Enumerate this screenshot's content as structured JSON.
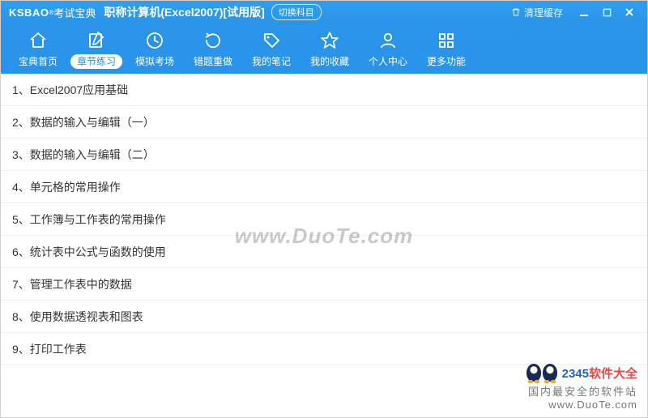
{
  "title": {
    "logo_en": "KSBAO",
    "logo_sup": "®",
    "logo_cn": "考试宝典",
    "main": "职称计算机(Excel2007)",
    "trial": "[试用版]",
    "switch_subject": "切换科目",
    "clear_cache": "清理缓存"
  },
  "toolbar": {
    "items": [
      {
        "label": "宝典首页",
        "icon": "home"
      },
      {
        "label": "章节练习",
        "icon": "edit",
        "active": true
      },
      {
        "label": "模拟考场",
        "icon": "clock"
      },
      {
        "label": "错题重做",
        "icon": "redo"
      },
      {
        "label": "我的笔记",
        "icon": "tag"
      },
      {
        "label": "我的收藏",
        "icon": "star"
      },
      {
        "label": "个人中心",
        "icon": "user"
      },
      {
        "label": "更多功能",
        "icon": "grid"
      }
    ]
  },
  "chapters": [
    "1、Excel2007应用基础",
    "2、数据的输入与编辑（一）",
    "3、数据的输入与编辑（二）",
    "4、单元格的常用操作",
    "5、工作簿与工作表的常用操作",
    "6、统计表中公式与函数的使用",
    "7、管理工作表中的数据",
    "8、使用数据透视表和图表",
    "9、打印工作表"
  ],
  "watermark": {
    "center": "www.DuoTe.com",
    "brand_num": "2345",
    "brand_text": "软件大全",
    "slogan": "国内最安全的软件站",
    "url": "www.DuoTe.com"
  }
}
